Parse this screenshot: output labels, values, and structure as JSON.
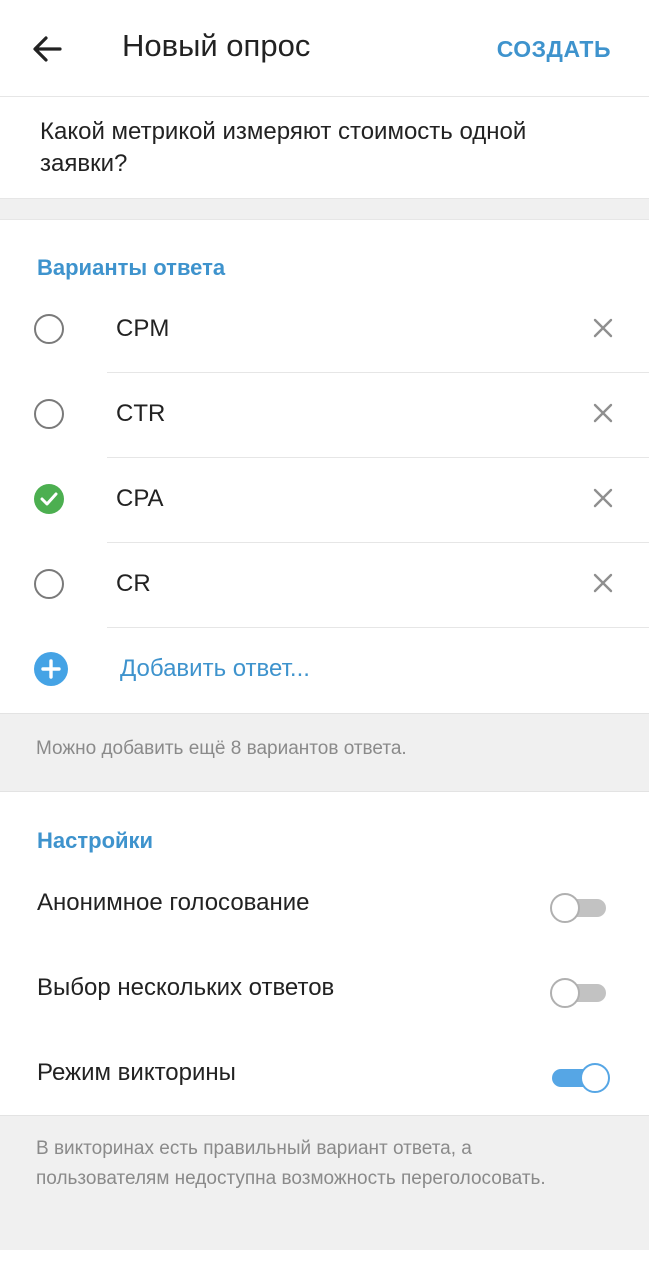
{
  "header": {
    "title": "Новый опрос",
    "create_label": "СОЗДАТЬ"
  },
  "question": {
    "text": "Какой метрикой измеряют стоимость одной заявки?"
  },
  "answers": {
    "section_title": "Варианты ответа",
    "options": [
      {
        "text": "CPM",
        "correct": false
      },
      {
        "text": "CTR",
        "correct": false
      },
      {
        "text": "CPA",
        "correct": true
      },
      {
        "text": "CR",
        "correct": false
      }
    ],
    "add_label": "Добавить ответ...",
    "hint": "Можно добавить ещё 8 вариантов ответа."
  },
  "settings": {
    "section_title": "Настройки",
    "items": [
      {
        "label": "Анонимное голосование",
        "enabled": false
      },
      {
        "label": "Выбор нескольких ответов",
        "enabled": false
      },
      {
        "label": "Режим викторины",
        "enabled": true
      }
    ],
    "quiz_hint": "В викторинах есть правильный вариант ответа, а пользователям недоступна возможность переголосовать."
  },
  "colors": {
    "accent": "#3e93cd",
    "correct": "#4caf50",
    "toggle_on": "#56a6e5"
  },
  "icons": {
    "back": "arrow-left-icon",
    "remove": "close-icon",
    "add": "plus-circle-icon",
    "check": "checkmark-icon"
  }
}
